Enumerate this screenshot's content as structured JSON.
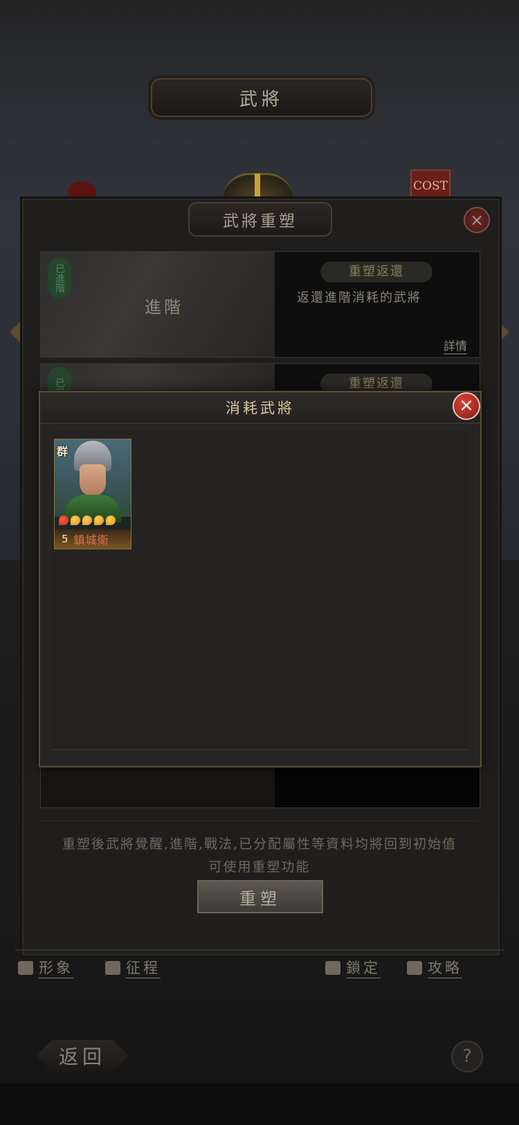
{
  "top_title": "武將",
  "cost_badge": "COST",
  "reforge_dialog": {
    "title": "武將重塑",
    "close": "×",
    "options": [
      {
        "stamp": "已進階",
        "thumb_label": "進階",
        "tag": "重塑返還",
        "desc": "返還進階消耗的武將",
        "details": "詳情"
      },
      {
        "stamp": "已覺",
        "tag": "重塑返還"
      }
    ],
    "notice_line1": "重塑後武將覺醒,進階,戰法,已分配屬性等資料均將回到初始值",
    "notice_line2": "可使用重塑功能",
    "reforge_button": "重塑"
  },
  "consumed_modal": {
    "title": "消耗武將",
    "close": "×",
    "cards": [
      {
        "faction": "群",
        "cost": "5",
        "name": "鎮城衛",
        "stars": 5
      }
    ]
  },
  "footer": {
    "items": [
      {
        "label": "形象",
        "icon": "person-icon"
      },
      {
        "label": "征程",
        "icon": "flag-icon"
      },
      {
        "label": "鎖定",
        "icon": "lock-icon"
      },
      {
        "label": "攻略",
        "icon": "book-icon"
      }
    ],
    "back": "返回",
    "help": "?"
  },
  "colors": {
    "accent_gold": "#d8c9a3",
    "close_red": "#d8443a",
    "card_name": "#e07050"
  }
}
